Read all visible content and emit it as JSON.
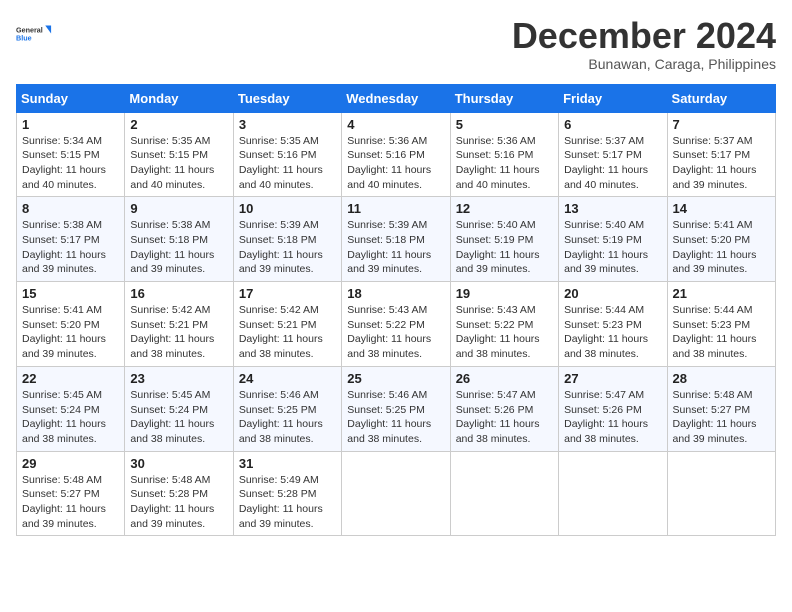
{
  "header": {
    "logo_line1": "General",
    "logo_line2": "Blue",
    "month_title": "December 2024",
    "subtitle": "Bunawan, Caraga, Philippines"
  },
  "days_of_week": [
    "Sunday",
    "Monday",
    "Tuesday",
    "Wednesday",
    "Thursday",
    "Friday",
    "Saturday"
  ],
  "weeks": [
    [
      {
        "day": "1",
        "info": "Sunrise: 5:34 AM\nSunset: 5:15 PM\nDaylight: 11 hours and 40 minutes."
      },
      {
        "day": "2",
        "info": "Sunrise: 5:35 AM\nSunset: 5:15 PM\nDaylight: 11 hours and 40 minutes."
      },
      {
        "day": "3",
        "info": "Sunrise: 5:35 AM\nSunset: 5:16 PM\nDaylight: 11 hours and 40 minutes."
      },
      {
        "day": "4",
        "info": "Sunrise: 5:36 AM\nSunset: 5:16 PM\nDaylight: 11 hours and 40 minutes."
      },
      {
        "day": "5",
        "info": "Sunrise: 5:36 AM\nSunset: 5:16 PM\nDaylight: 11 hours and 40 minutes."
      },
      {
        "day": "6",
        "info": "Sunrise: 5:37 AM\nSunset: 5:17 PM\nDaylight: 11 hours and 40 minutes."
      },
      {
        "day": "7",
        "info": "Sunrise: 5:37 AM\nSunset: 5:17 PM\nDaylight: 11 hours and 39 minutes."
      }
    ],
    [
      {
        "day": "8",
        "info": "Sunrise: 5:38 AM\nSunset: 5:17 PM\nDaylight: 11 hours and 39 minutes."
      },
      {
        "day": "9",
        "info": "Sunrise: 5:38 AM\nSunset: 5:18 PM\nDaylight: 11 hours and 39 minutes."
      },
      {
        "day": "10",
        "info": "Sunrise: 5:39 AM\nSunset: 5:18 PM\nDaylight: 11 hours and 39 minutes."
      },
      {
        "day": "11",
        "info": "Sunrise: 5:39 AM\nSunset: 5:18 PM\nDaylight: 11 hours and 39 minutes."
      },
      {
        "day": "12",
        "info": "Sunrise: 5:40 AM\nSunset: 5:19 PM\nDaylight: 11 hours and 39 minutes."
      },
      {
        "day": "13",
        "info": "Sunrise: 5:40 AM\nSunset: 5:19 PM\nDaylight: 11 hours and 39 minutes."
      },
      {
        "day": "14",
        "info": "Sunrise: 5:41 AM\nSunset: 5:20 PM\nDaylight: 11 hours and 39 minutes."
      }
    ],
    [
      {
        "day": "15",
        "info": "Sunrise: 5:41 AM\nSunset: 5:20 PM\nDaylight: 11 hours and 39 minutes."
      },
      {
        "day": "16",
        "info": "Sunrise: 5:42 AM\nSunset: 5:21 PM\nDaylight: 11 hours and 38 minutes."
      },
      {
        "day": "17",
        "info": "Sunrise: 5:42 AM\nSunset: 5:21 PM\nDaylight: 11 hours and 38 minutes."
      },
      {
        "day": "18",
        "info": "Sunrise: 5:43 AM\nSunset: 5:22 PM\nDaylight: 11 hours and 38 minutes."
      },
      {
        "day": "19",
        "info": "Sunrise: 5:43 AM\nSunset: 5:22 PM\nDaylight: 11 hours and 38 minutes."
      },
      {
        "day": "20",
        "info": "Sunrise: 5:44 AM\nSunset: 5:23 PM\nDaylight: 11 hours and 38 minutes."
      },
      {
        "day": "21",
        "info": "Sunrise: 5:44 AM\nSunset: 5:23 PM\nDaylight: 11 hours and 38 minutes."
      }
    ],
    [
      {
        "day": "22",
        "info": "Sunrise: 5:45 AM\nSunset: 5:24 PM\nDaylight: 11 hours and 38 minutes."
      },
      {
        "day": "23",
        "info": "Sunrise: 5:45 AM\nSunset: 5:24 PM\nDaylight: 11 hours and 38 minutes."
      },
      {
        "day": "24",
        "info": "Sunrise: 5:46 AM\nSunset: 5:25 PM\nDaylight: 11 hours and 38 minutes."
      },
      {
        "day": "25",
        "info": "Sunrise: 5:46 AM\nSunset: 5:25 PM\nDaylight: 11 hours and 38 minutes."
      },
      {
        "day": "26",
        "info": "Sunrise: 5:47 AM\nSunset: 5:26 PM\nDaylight: 11 hours and 38 minutes."
      },
      {
        "day": "27",
        "info": "Sunrise: 5:47 AM\nSunset: 5:26 PM\nDaylight: 11 hours and 38 minutes."
      },
      {
        "day": "28",
        "info": "Sunrise: 5:48 AM\nSunset: 5:27 PM\nDaylight: 11 hours and 39 minutes."
      }
    ],
    [
      {
        "day": "29",
        "info": "Sunrise: 5:48 AM\nSunset: 5:27 PM\nDaylight: 11 hours and 39 minutes."
      },
      {
        "day": "30",
        "info": "Sunrise: 5:48 AM\nSunset: 5:28 PM\nDaylight: 11 hours and 39 minutes."
      },
      {
        "day": "31",
        "info": "Sunrise: 5:49 AM\nSunset: 5:28 PM\nDaylight: 11 hours and 39 minutes."
      },
      {
        "day": "",
        "info": ""
      },
      {
        "day": "",
        "info": ""
      },
      {
        "day": "",
        "info": ""
      },
      {
        "day": "",
        "info": ""
      }
    ]
  ]
}
